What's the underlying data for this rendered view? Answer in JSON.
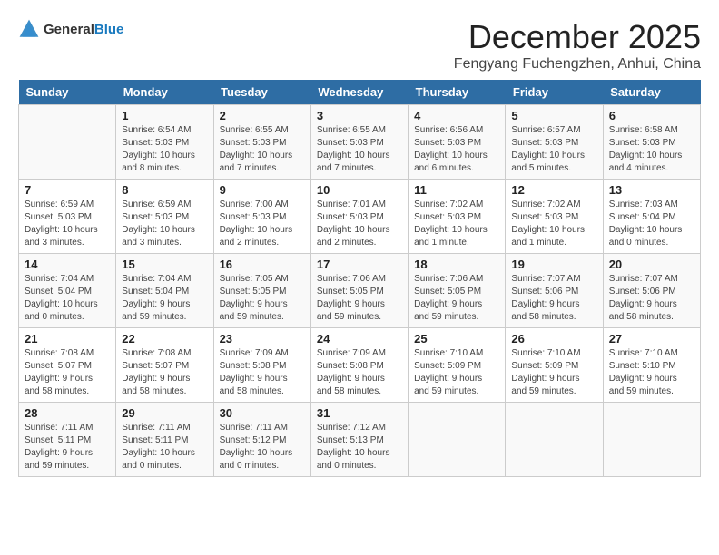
{
  "header": {
    "logo_general": "General",
    "logo_blue": "Blue",
    "month_title": "December 2025",
    "location": "Fengyang Fuchengzhen, Anhui, China"
  },
  "weekdays": [
    "Sunday",
    "Monday",
    "Tuesday",
    "Wednesday",
    "Thursday",
    "Friday",
    "Saturday"
  ],
  "weeks": [
    [
      {
        "day": "",
        "info": ""
      },
      {
        "day": "1",
        "info": "Sunrise: 6:54 AM\nSunset: 5:03 PM\nDaylight: 10 hours\nand 8 minutes."
      },
      {
        "day": "2",
        "info": "Sunrise: 6:55 AM\nSunset: 5:03 PM\nDaylight: 10 hours\nand 7 minutes."
      },
      {
        "day": "3",
        "info": "Sunrise: 6:55 AM\nSunset: 5:03 PM\nDaylight: 10 hours\nand 7 minutes."
      },
      {
        "day": "4",
        "info": "Sunrise: 6:56 AM\nSunset: 5:03 PM\nDaylight: 10 hours\nand 6 minutes."
      },
      {
        "day": "5",
        "info": "Sunrise: 6:57 AM\nSunset: 5:03 PM\nDaylight: 10 hours\nand 5 minutes."
      },
      {
        "day": "6",
        "info": "Sunrise: 6:58 AM\nSunset: 5:03 PM\nDaylight: 10 hours\nand 4 minutes."
      }
    ],
    [
      {
        "day": "7",
        "info": "Sunrise: 6:59 AM\nSunset: 5:03 PM\nDaylight: 10 hours\nand 3 minutes."
      },
      {
        "day": "8",
        "info": "Sunrise: 6:59 AM\nSunset: 5:03 PM\nDaylight: 10 hours\nand 3 minutes."
      },
      {
        "day": "9",
        "info": "Sunrise: 7:00 AM\nSunset: 5:03 PM\nDaylight: 10 hours\nand 2 minutes."
      },
      {
        "day": "10",
        "info": "Sunrise: 7:01 AM\nSunset: 5:03 PM\nDaylight: 10 hours\nand 2 minutes."
      },
      {
        "day": "11",
        "info": "Sunrise: 7:02 AM\nSunset: 5:03 PM\nDaylight: 10 hours\nand 1 minute."
      },
      {
        "day": "12",
        "info": "Sunrise: 7:02 AM\nSunset: 5:03 PM\nDaylight: 10 hours\nand 1 minute."
      },
      {
        "day": "13",
        "info": "Sunrise: 7:03 AM\nSunset: 5:04 PM\nDaylight: 10 hours\nand 0 minutes."
      }
    ],
    [
      {
        "day": "14",
        "info": "Sunrise: 7:04 AM\nSunset: 5:04 PM\nDaylight: 10 hours\nand 0 minutes."
      },
      {
        "day": "15",
        "info": "Sunrise: 7:04 AM\nSunset: 5:04 PM\nDaylight: 9 hours\nand 59 minutes."
      },
      {
        "day": "16",
        "info": "Sunrise: 7:05 AM\nSunset: 5:05 PM\nDaylight: 9 hours\nand 59 minutes."
      },
      {
        "day": "17",
        "info": "Sunrise: 7:06 AM\nSunset: 5:05 PM\nDaylight: 9 hours\nand 59 minutes."
      },
      {
        "day": "18",
        "info": "Sunrise: 7:06 AM\nSunset: 5:05 PM\nDaylight: 9 hours\nand 59 minutes."
      },
      {
        "day": "19",
        "info": "Sunrise: 7:07 AM\nSunset: 5:06 PM\nDaylight: 9 hours\nand 58 minutes."
      },
      {
        "day": "20",
        "info": "Sunrise: 7:07 AM\nSunset: 5:06 PM\nDaylight: 9 hours\nand 58 minutes."
      }
    ],
    [
      {
        "day": "21",
        "info": "Sunrise: 7:08 AM\nSunset: 5:07 PM\nDaylight: 9 hours\nand 58 minutes."
      },
      {
        "day": "22",
        "info": "Sunrise: 7:08 AM\nSunset: 5:07 PM\nDaylight: 9 hours\nand 58 minutes."
      },
      {
        "day": "23",
        "info": "Sunrise: 7:09 AM\nSunset: 5:08 PM\nDaylight: 9 hours\nand 58 minutes."
      },
      {
        "day": "24",
        "info": "Sunrise: 7:09 AM\nSunset: 5:08 PM\nDaylight: 9 hours\nand 58 minutes."
      },
      {
        "day": "25",
        "info": "Sunrise: 7:10 AM\nSunset: 5:09 PM\nDaylight: 9 hours\nand 59 minutes."
      },
      {
        "day": "26",
        "info": "Sunrise: 7:10 AM\nSunset: 5:09 PM\nDaylight: 9 hours\nand 59 minutes."
      },
      {
        "day": "27",
        "info": "Sunrise: 7:10 AM\nSunset: 5:10 PM\nDaylight: 9 hours\nand 59 minutes."
      }
    ],
    [
      {
        "day": "28",
        "info": "Sunrise: 7:11 AM\nSunset: 5:11 PM\nDaylight: 9 hours\nand 59 minutes."
      },
      {
        "day": "29",
        "info": "Sunrise: 7:11 AM\nSunset: 5:11 PM\nDaylight: 10 hours\nand 0 minutes."
      },
      {
        "day": "30",
        "info": "Sunrise: 7:11 AM\nSunset: 5:12 PM\nDaylight: 10 hours\nand 0 minutes."
      },
      {
        "day": "31",
        "info": "Sunrise: 7:12 AM\nSunset: 5:13 PM\nDaylight: 10 hours\nand 0 minutes."
      },
      {
        "day": "",
        "info": ""
      },
      {
        "day": "",
        "info": ""
      },
      {
        "day": "",
        "info": ""
      }
    ]
  ]
}
